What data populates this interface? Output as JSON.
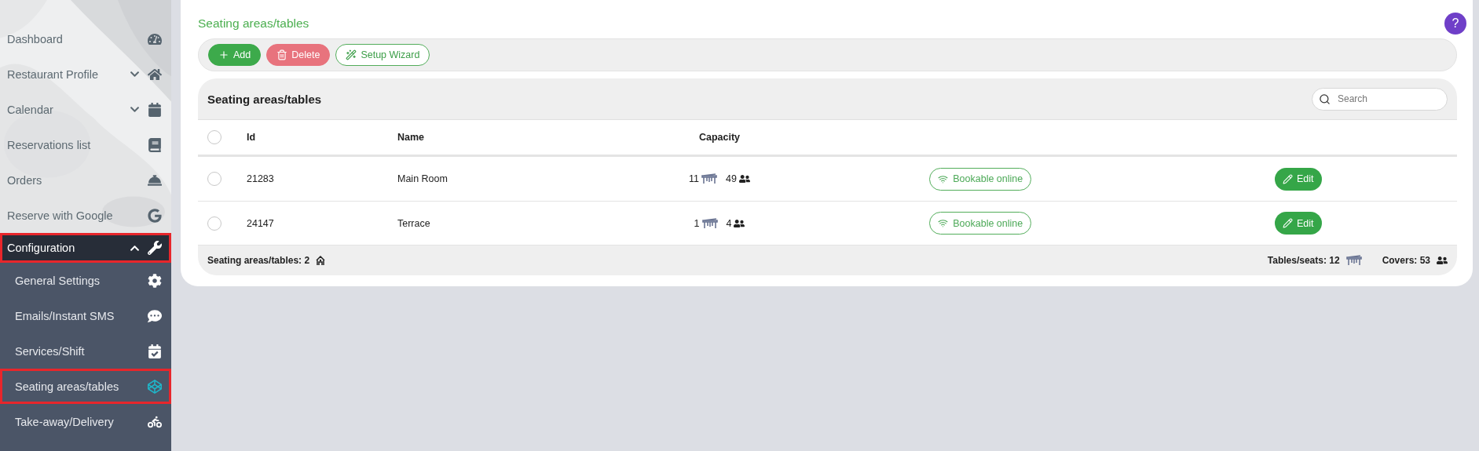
{
  "sidebar": {
    "items": [
      {
        "label": "Dashboard",
        "selected": false,
        "highlighted": false
      },
      {
        "label": "Restaurant Profile",
        "selected": false,
        "highlighted": false,
        "expanded": false
      },
      {
        "label": "Calendar",
        "selected": false,
        "highlighted": false,
        "expanded": false
      },
      {
        "label": "Reservations list",
        "selected": false,
        "highlighted": false
      },
      {
        "label": "Orders",
        "selected": false,
        "highlighted": false
      },
      {
        "label": "Reserve with Google",
        "selected": false,
        "highlighted": false
      },
      {
        "label": "Configuration",
        "selected": false,
        "highlighted": true,
        "expanded": true,
        "children": [
          {
            "label": "General Settings",
            "selected": false,
            "highlighted": false
          },
          {
            "label": "Emails/Instant SMS",
            "selected": false,
            "highlighted": false
          },
          {
            "label": "Services/Shift",
            "selected": false,
            "highlighted": false
          },
          {
            "label": "Seating areas/tables",
            "selected": true,
            "highlighted": true
          },
          {
            "label": "Take-away/Delivery",
            "selected": false,
            "highlighted": false
          }
        ]
      }
    ]
  },
  "page": {
    "title": "Seating areas/tables",
    "help": "?"
  },
  "toolbar": {
    "buttons": [
      {
        "label": "Add",
        "kind": "add"
      },
      {
        "label": "Delete",
        "kind": "delete"
      },
      {
        "label": "Setup Wizard",
        "kind": "wizard"
      }
    ]
  },
  "table": {
    "title": "Seating areas/tables",
    "search": {
      "placeholder": "Search"
    },
    "columns": [
      "Id",
      "Name",
      "Capacity"
    ],
    "header_checked": false,
    "rows": [
      {
        "checked": false,
        "id": "21283",
        "name": "Main Room",
        "tables": "11",
        "covers": "49",
        "status": "Bookable online",
        "action": "Edit"
      },
      {
        "checked": false,
        "id": "24147",
        "name": "Terrace",
        "tables": "1",
        "covers": "4",
        "status": "Bookable online",
        "action": "Edit"
      }
    ],
    "footer": {
      "count": "Seating areas/tables: 2",
      "tables": "Tables/seats: 12",
      "covers": "Covers: 53"
    }
  }
}
